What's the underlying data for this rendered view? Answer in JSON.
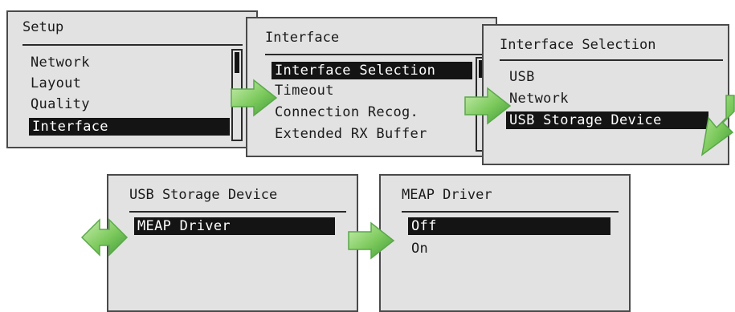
{
  "screens": {
    "setup": {
      "title": "Setup",
      "items": [
        "Network",
        "Layout",
        "Quality",
        "Interface"
      ]
    },
    "interface": {
      "title": "Interface",
      "items": [
        "Interface Selection",
        "Timeout",
        "Connection Recog.",
        "Extended RX Buffer"
      ]
    },
    "interface_selection": {
      "title": "Interface Selection",
      "items": [
        "USB",
        "Network",
        "USB Storage Device"
      ]
    },
    "usb_storage": {
      "title": "USB Storage Device",
      "items": [
        "MEAP Driver"
      ]
    },
    "meap_driver": {
      "title": "MEAP Driver",
      "items": [
        "Off",
        "On"
      ]
    }
  },
  "colors": {
    "screen_bg": "#e2e2e2",
    "highlight": "#141414",
    "arrow_light": "#b6e39a",
    "arrow_dark": "#3f9a38"
  },
  "icons": {
    "arrow": "green-flow-arrow-icon"
  }
}
